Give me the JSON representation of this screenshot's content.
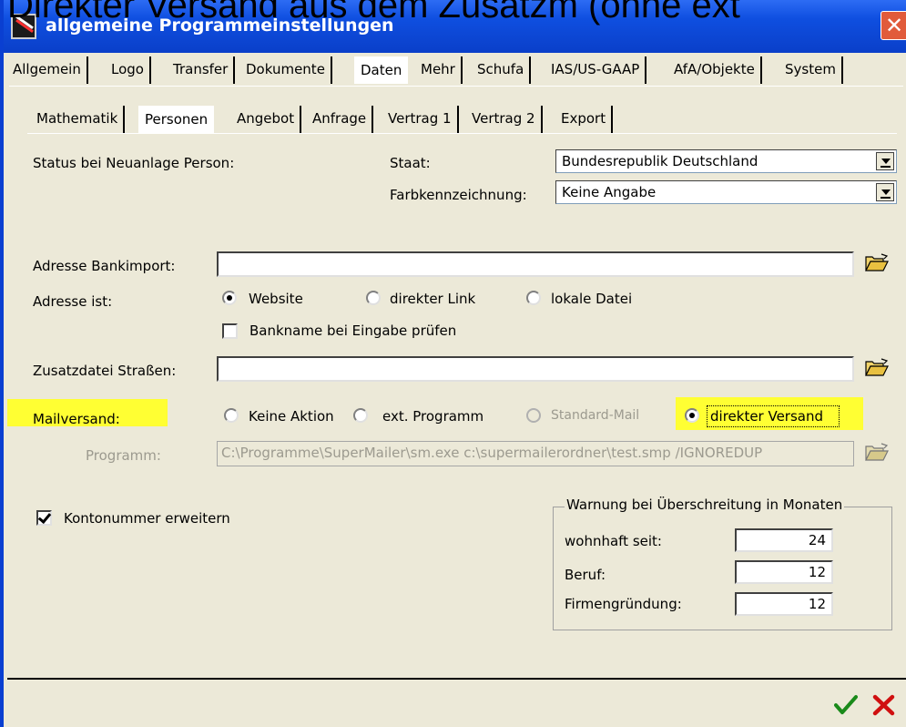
{
  "overlay_heading": "Direkter Versand aus dem Zusatzm (ohne ext",
  "window": {
    "title": "allgemeine Programmeinstellungen",
    "close_glyph": "✕"
  },
  "main_tabs": [
    {
      "label": "Allgemein"
    },
    {
      "label": "Logo"
    },
    {
      "label": "Transfer"
    },
    {
      "label": "Dokumente"
    },
    {
      "label": "Daten"
    },
    {
      "label": "Mehr"
    },
    {
      "label": "Schufa"
    },
    {
      "label": "IAS/US-GAAP"
    },
    {
      "label": "AfA/Objekte"
    },
    {
      "label": "System"
    }
  ],
  "sub_tabs": [
    {
      "label": "Mathematik"
    },
    {
      "label": "Personen"
    },
    {
      "label": "Angebot"
    },
    {
      "label": "Anfrage"
    },
    {
      "label": "Vertrag 1"
    },
    {
      "label": "Vertrag 2"
    },
    {
      "label": "Export"
    }
  ],
  "status": {
    "label": "Status bei Neuanlage Person:",
    "staat_label": "Staat:",
    "staat_value": "Bundesrepublik Deutschland",
    "farb_label": "Farbkennzeichnung:",
    "farb_value": "Keine Angabe"
  },
  "bankimport": {
    "label": "Adresse Bankimport:",
    "value": ""
  },
  "adresse_ist": {
    "label": "Adresse ist:",
    "options": [
      {
        "label": "Website",
        "checked": true
      },
      {
        "label": "direkter Link",
        "checked": false
      },
      {
        "label": "lokale Datei",
        "checked": false
      }
    ],
    "bankname_check_label": "Bankname bei Eingabe prüfen",
    "bankname_checked": false
  },
  "zusatzdatei": {
    "label": "Zusatzdatei Straßen:",
    "value": ""
  },
  "mailversand": {
    "label": "Mailversand:",
    "options": [
      {
        "label": "Keine Aktion",
        "checked": false,
        "disabled": false
      },
      {
        "label": "ext. Programm",
        "checked": false,
        "disabled": false
      },
      {
        "label": "Standard-Mail",
        "checked": false,
        "disabled": true
      },
      {
        "label": "direkter Versand",
        "checked": true,
        "disabled": false
      }
    ],
    "highlight_color": "#ffff33"
  },
  "programm": {
    "label": "Programm:",
    "value": "C:\\Programme\\SuperMailer\\sm.exe c:\\supermailerordner\\test.smp /IGNOREDUP"
  },
  "kontonummer": {
    "label": "Kontonummer erweitern",
    "checked": true
  },
  "warnung": {
    "title": "Warnung bei Überschreitung in Monaten",
    "rows": [
      {
        "label": "wohnhaft seit:",
        "value": "24"
      },
      {
        "label": "Beruf:",
        "value": "12"
      },
      {
        "label": "Firmengründung:",
        "value": "12"
      }
    ]
  },
  "footer": {
    "ok_icon": "check-icon",
    "cancel_icon": "x-icon",
    "ok_color": "#1a8a1a",
    "cancel_color": "#d01010"
  }
}
